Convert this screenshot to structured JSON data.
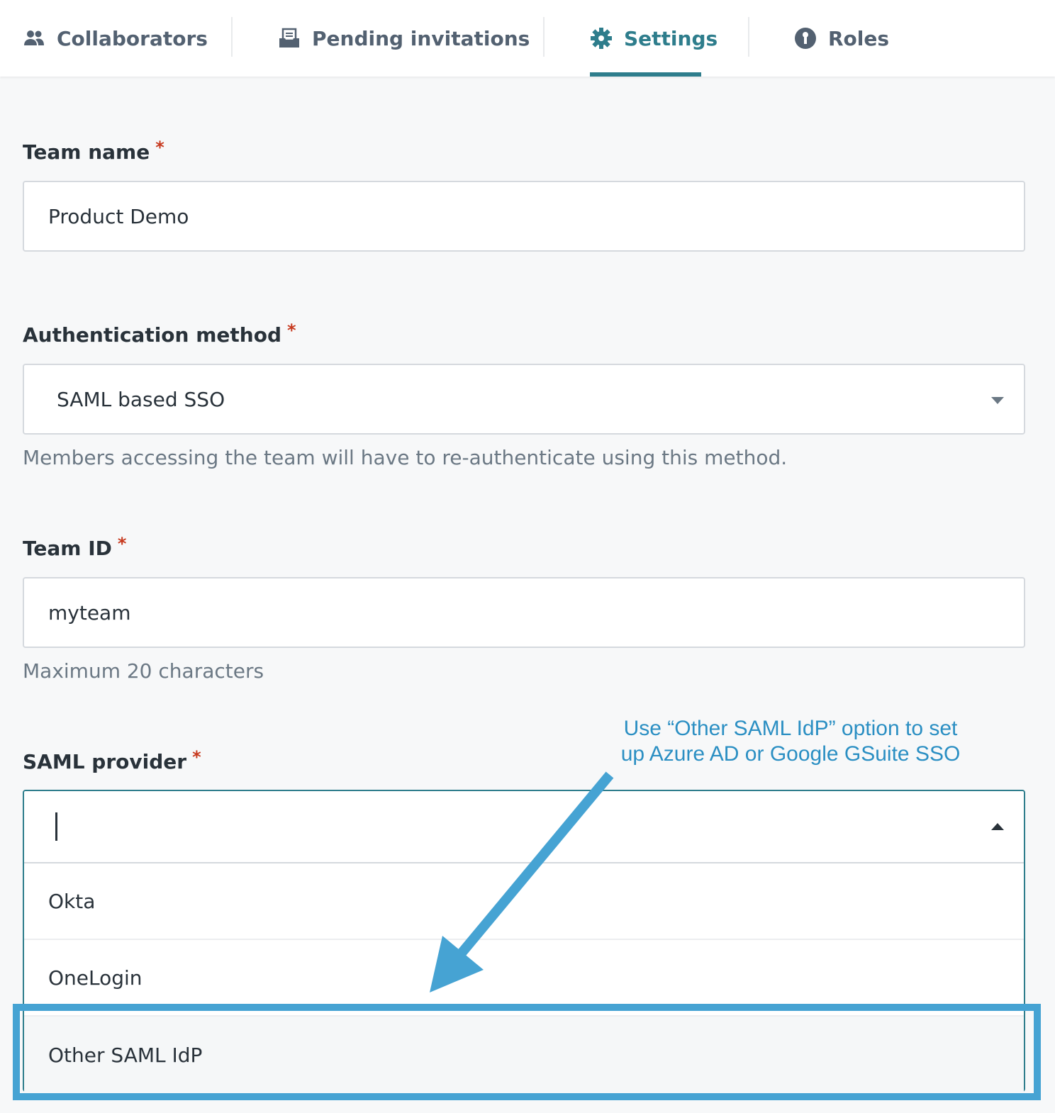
{
  "tabs": [
    {
      "label": "Collaborators",
      "icon": "people-icon"
    },
    {
      "label": "Pending invitations",
      "icon": "inbox-icon"
    },
    {
      "label": "Settings",
      "icon": "gear-icon",
      "active": true
    },
    {
      "label": "Roles",
      "icon": "info-lock-icon"
    }
  ],
  "form": {
    "team_name": {
      "label": "Team name",
      "required": "*",
      "value": "Product Demo"
    },
    "auth_method": {
      "label": "Authentication method",
      "required": "*",
      "value": "SAML based SSO",
      "help": "Members accessing the team will have to re-authenticate using this method."
    },
    "team_id": {
      "label": "Team ID",
      "required": "*",
      "value": "myteam",
      "help": "Maximum 20 characters"
    },
    "saml_provider": {
      "label": "SAML provider",
      "required": "*",
      "value": "",
      "options": [
        "Okta",
        "OneLogin",
        "Other SAML IdP"
      ],
      "highlighted_option": "Other SAML IdP"
    }
  },
  "annotation": {
    "line1": "Use “Other SAML IdP” option to set",
    "line2": "up Azure AD or Google GSuite SSO"
  },
  "colors": {
    "accent": "#2e7d8c",
    "required": "#c7391e",
    "annotation": "#46a3d3"
  }
}
